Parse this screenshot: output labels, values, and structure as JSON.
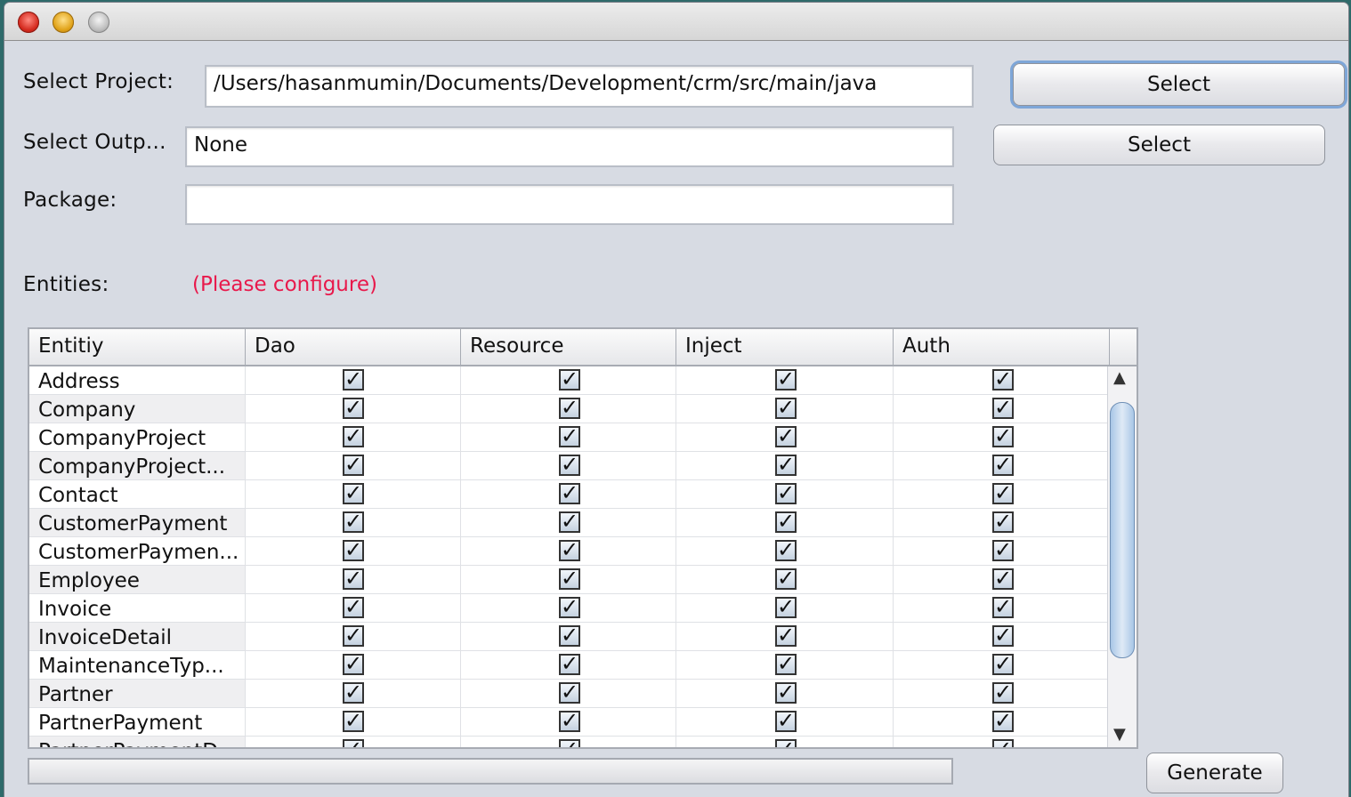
{
  "window": {
    "traffic_lights": [
      "close-icon",
      "minimize-icon",
      "zoom-icon"
    ]
  },
  "form": {
    "project_label": "Select Project:",
    "project_value": "/Users/hasanmumin/Documents/Development/crm/src/main/java",
    "project_button": "Select",
    "output_label": "Select Outp...",
    "output_value": "None",
    "output_button": "Select",
    "package_label": "Package:",
    "package_value": "",
    "entities_label": "Entities:",
    "entities_warning": "(Please configure)",
    "warning_color": "#e8194b"
  },
  "table": {
    "headers": [
      "Entitiy",
      "Dao",
      "Resource",
      "Inject",
      "Auth"
    ],
    "rows": [
      {
        "name": "Address",
        "dao": true,
        "resource": true,
        "inject": true,
        "auth": true
      },
      {
        "name": "Company",
        "dao": true,
        "resource": true,
        "inject": true,
        "auth": true
      },
      {
        "name": "CompanyProject",
        "dao": true,
        "resource": true,
        "inject": true,
        "auth": true
      },
      {
        "name": "CompanyProject...",
        "dao": true,
        "resource": true,
        "inject": true,
        "auth": true
      },
      {
        "name": "Contact",
        "dao": true,
        "resource": true,
        "inject": true,
        "auth": true
      },
      {
        "name": "CustomerPayment",
        "dao": true,
        "resource": true,
        "inject": true,
        "auth": true
      },
      {
        "name": "CustomerPaymen...",
        "dao": true,
        "resource": true,
        "inject": true,
        "auth": true
      },
      {
        "name": "Employee",
        "dao": true,
        "resource": true,
        "inject": true,
        "auth": true
      },
      {
        "name": "Invoice",
        "dao": true,
        "resource": true,
        "inject": true,
        "auth": true
      },
      {
        "name": "InvoiceDetail",
        "dao": true,
        "resource": true,
        "inject": true,
        "auth": true
      },
      {
        "name": "MaintenanceTyp...",
        "dao": true,
        "resource": true,
        "inject": true,
        "auth": true
      },
      {
        "name": "Partner",
        "dao": true,
        "resource": true,
        "inject": true,
        "auth": true
      },
      {
        "name": "PartnerPayment",
        "dao": true,
        "resource": true,
        "inject": true,
        "auth": true
      },
      {
        "name": "PartnerPaymentD...",
        "dao": true,
        "resource": true,
        "inject": true,
        "auth": true
      }
    ],
    "check_glyph": "✓"
  },
  "footer": {
    "progress_value": 0,
    "generate_button": "Generate"
  }
}
